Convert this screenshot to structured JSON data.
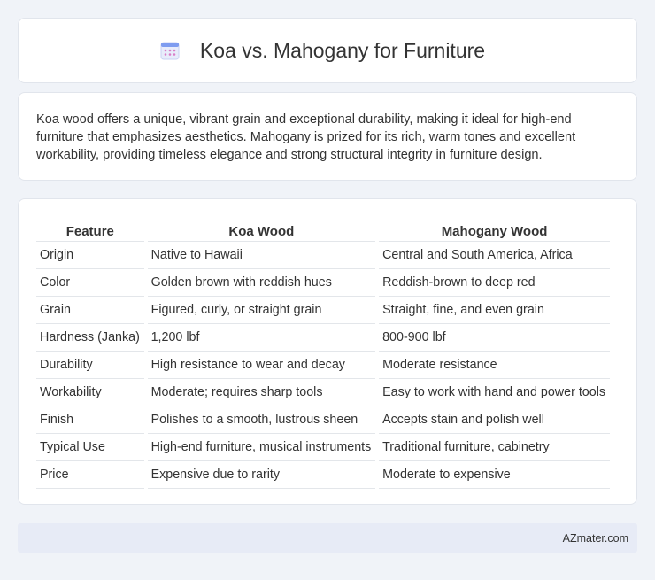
{
  "title": "Koa vs. Mahogany for Furniture",
  "title_icon": "calendar-icon",
  "intro": "Koa wood offers a unique, vibrant grain and exceptional durability, making it ideal for high-end furniture that emphasizes aesthetics. Mahogany is prized for its rich, warm tones and excellent workability, providing timeless elegance and strong structural integrity in furniture design.",
  "table": {
    "headers": [
      "Feature",
      "Koa Wood",
      "Mahogany Wood"
    ],
    "rows": [
      [
        "Origin",
        "Native to Hawaii",
        "Central and South America, Africa"
      ],
      [
        "Color",
        "Golden brown with reddish hues",
        "Reddish-brown to deep red"
      ],
      [
        "Grain",
        "Figured, curly, or straight grain",
        "Straight, fine, and even grain"
      ],
      [
        "Hardness (Janka)",
        "1,200 lbf",
        "800-900 lbf"
      ],
      [
        "Durability",
        "High resistance to wear and decay",
        "Moderate resistance"
      ],
      [
        "Workability",
        "Moderate; requires sharp tools",
        "Easy to work with hand and power tools"
      ],
      [
        "Finish",
        "Polishes to a smooth, lustrous sheen",
        "Accepts stain and polish well"
      ],
      [
        "Typical Use",
        "High-end furniture, musical instruments",
        "Traditional furniture, cabinetry"
      ],
      [
        "Price",
        "Expensive due to rarity",
        "Moderate to expensive"
      ]
    ]
  },
  "footer": "AZmater.com",
  "colors": {
    "background": "#f0f3f8",
    "card": "#ffffff",
    "footer_bg": "#e7ebf6",
    "icon_accent": "#5b7fe0"
  }
}
